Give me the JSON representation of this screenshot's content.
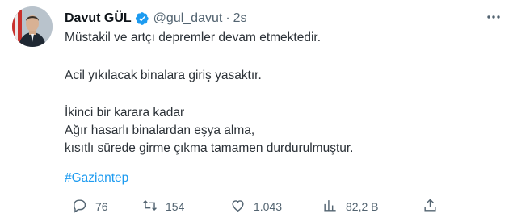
{
  "tweet": {
    "author_name": "Davut GÜL",
    "handle": "@gul_davut",
    "separator": "·",
    "time": "2s",
    "lines": [
      "Müstakil ve artçı depremler devam etmektedir.",
      "Acil yıkılacak binalara giriş yasaktır.",
      "İkinci bir karara kadar",
      "Ağır hasarlı binalardan eşya alma,",
      "kısıtlı sürede girme çıkma tamamen durdurulmuştur."
    ],
    "hashtag": "#Gaziantep"
  },
  "actions": {
    "reply_count": "76",
    "retweet_count": "154",
    "like_count": "1.043",
    "views_count": "82,2 B"
  },
  "icons": {
    "verified": "verified-badge-icon",
    "more": "more-options-icon",
    "reply": "reply-icon",
    "retweet": "retweet-icon",
    "like": "heart-icon",
    "views": "views-chart-icon",
    "share": "share-icon"
  },
  "colors": {
    "accent": "#1d9bf0",
    "text": "#0f1419",
    "muted": "#536471"
  }
}
